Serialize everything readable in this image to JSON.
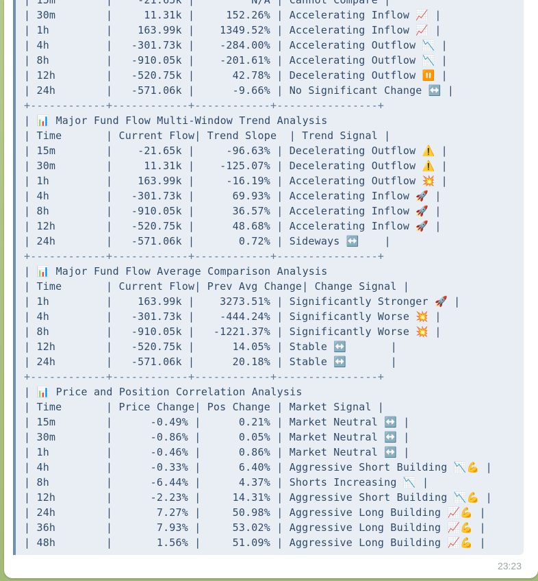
{
  "message": {
    "time": "23:23",
    "lines": [
      "| 15m        |    -21.65k |         N/A | Cannot Compare |",
      "| 30m        |     11.31k |     152.26% | Accelerating Inflow 📈 |",
      "| 1h         |    163.99k |    1349.52% | Accelerating Inflow 📈 |",
      "| 4h         |   -301.73k |    -284.00% | Accelerating Outflow 📉 |",
      "| 8h         |   -910.05k |    -201.61% | Accelerating Outflow 📉 |",
      "| 12h        |   -520.75k |      42.78% | Decelerating Outflow ⏸️ |",
      "| 24h        |   -571.06k |      -9.66% | No Significant Change ↔️ |",
      "+------------+------------+------------+----------------+",
      "| 📊 Major Fund Flow Multi-Window Trend Analysis",
      "| Time       | Current Flow| Trend Slope  | Trend Signal |",
      "| 15m        |    -21.65k |     -96.63% | Decelerating Outflow ⚠️ |",
      "| 30m        |     11.31k |    -125.07% | Decelerating Outflow ⚠️ |",
      "| 1h         |    163.99k |     -16.19% | Accelerating Outflow 💥 |",
      "| 4h         |   -301.73k |      69.93% | Accelerating Inflow 🚀 |",
      "| 8h         |   -910.05k |      36.57% | Accelerating Inflow 🚀 |",
      "| 12h        |   -520.75k |      48.68% | Accelerating Inflow 🚀 |",
      "| 24h        |   -571.06k |       0.72% | Sideways ↔️    |",
      "+------------+------------+------------+----------------+",
      "| 📊 Major Fund Flow Average Comparison Analysis",
      "| Time       | Current Flow| Prev Avg Change| Change Signal |",
      "| 1h         |    163.99k |    3273.51% | Significantly Stronger 🚀 |",
      "| 4h         |   -301.73k |    -444.24% | Significantly Worse 💥 |",
      "| 8h         |   -910.05k |   -1221.37% | Significantly Worse 💥 |",
      "| 12h        |   -520.75k |      14.05% | Stable ↔️       |",
      "| 24h        |   -571.06k |      20.18% | Stable ↔️       |",
      "+------------+------------+------------+----------------+",
      "| 📊 Price and Position Correlation Analysis",
      "| Time       | Price Change| Pos Change | Market Signal |",
      "| 15m        |      -0.49% |      0.21% | Market Neutral ↔️ |",
      "| 30m        |      -0.86% |      0.05% | Market Neutral ↔️ |",
      "| 1h         |      -0.46% |      0.86% | Market Neutral ↔️ |",
      "| 4h         |      -0.33% |      6.40% | Aggressive Short Building 📉💪 |",
      "| 8h         |      -6.44% |      4.37% | Shorts Increasing 📉 |",
      "| 12h        |      -2.23% |     14.31% | Aggressive Short Building 📉💪 |",
      "| 24h        |       7.27% |     50.98% | Aggressive Long Building 📈💪 |",
      "| 36h        |       7.93% |     53.02% | Aggressive Long Building 📈💪 |",
      "| 48h        |       1.56% |     51.09% | Aggressive Long Building 📈💪 |"
    ]
  }
}
